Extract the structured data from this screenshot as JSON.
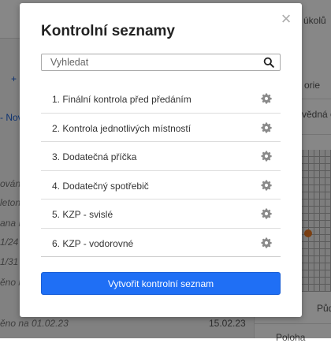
{
  "background": {
    "top_right_text": "úkolů",
    "left_link": "+ ",
    "left_new": "- Nov",
    "right_col1": "orie",
    "right_col2": "vědná o",
    "left_rows": [
      "ování",
      "leton",
      "ana N",
      "1/24",
      "1/31",
      "ěno n"
    ],
    "bottom_left": "ěno na 01.02.23",
    "bottom_date": "15.02.23",
    "right_bottom1": "Půd",
    "right_bottom2": "Poloha"
  },
  "modal": {
    "title": "Kontrolní seznamy",
    "close_label": "×",
    "search_placeholder": "Vyhledat",
    "items": [
      {
        "label": "1. Finální kontrola před předáním"
      },
      {
        "label": "2. Kontrola jednotlivých místností"
      },
      {
        "label": "3. Dodatečná příčka"
      },
      {
        "label": "4. Dodatečný spotřebič"
      },
      {
        "label": "5. KZP - svislé"
      },
      {
        "label": "6. KZP - vodorovné"
      }
    ],
    "create_button": "Vytvořit kontrolní seznam"
  },
  "colors": {
    "primary": "#1f6ff5",
    "overlay": "rgba(0,0,0,0.47)"
  },
  "icons": {
    "search": "search-icon",
    "settings": "gear-icon",
    "close": "close-icon"
  }
}
